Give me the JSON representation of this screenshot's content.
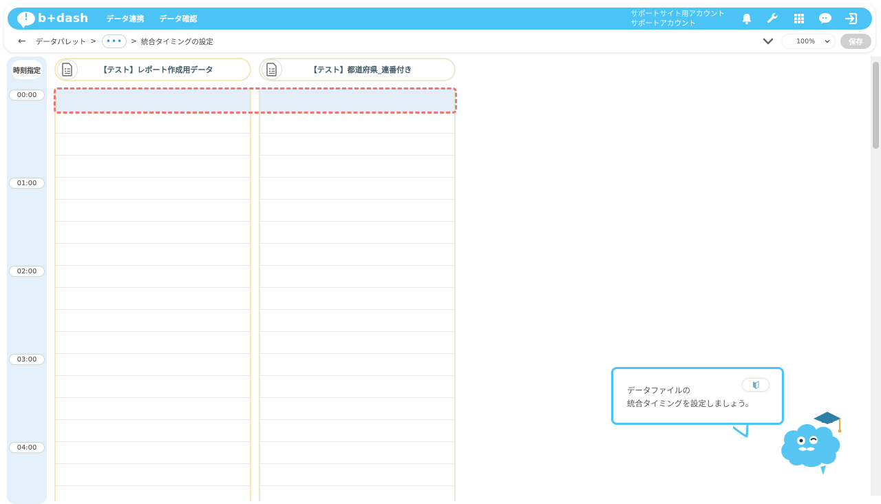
{
  "app": {
    "logo_text": "b+dash"
  },
  "topnav": {
    "items": [
      "データ連携",
      "データ確認"
    ]
  },
  "account": {
    "line1": "サポートサイト用アカウント",
    "line2": "サポートアカウント"
  },
  "breadcrumb": {
    "back_icon": "arrow-left-icon",
    "palette": "データパレット",
    "sep": ">",
    "more": "•••",
    "current": "統合タイミングの設定"
  },
  "toolbar": {
    "zoom": "100%",
    "save_label": "保存"
  },
  "timeline": {
    "spec_label": "時刻指定",
    "labels": [
      "00:00",
      "01:00",
      "02:00",
      "03:00",
      "04:00"
    ],
    "rows_per_hour": 4
  },
  "datasets": [
    {
      "title": "【テスト】レポート作成用データ",
      "icon": "document-icon",
      "border": "#f8e8b2"
    },
    {
      "title": "【テスト】都道府県_連番付き",
      "icon": "document-icon",
      "border": "#e4ebd2"
    }
  ],
  "tooltip": {
    "line1": "データファイルの",
    "line2": "統合タイミングを設定しましょう。"
  },
  "colors": {
    "accent": "#4cc3f5",
    "highlight": "#e3eef9",
    "selection": "#f07575"
  }
}
